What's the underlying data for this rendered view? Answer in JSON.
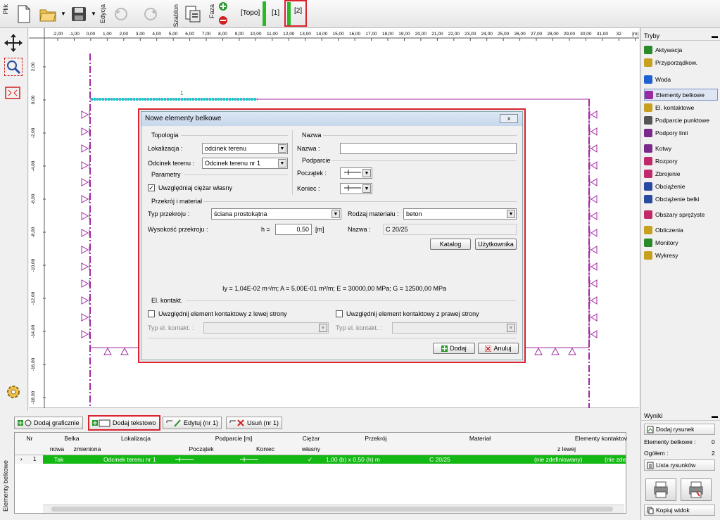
{
  "toolbar": {
    "file_label": "Plik",
    "edit_label": "Edycja",
    "template_label": "Szablon",
    "phase_label": "Faza",
    "phases": [
      "[Topo]",
      "[1]",
      "[2]"
    ]
  },
  "ruler": {
    "x_ticks": [
      "-2,00",
      "-1,00",
      "0,00",
      "1,00",
      "2,00",
      "3,00",
      "4,00",
      "5,00",
      "6,00",
      "7,00",
      "8,00",
      "9,00",
      "10,00",
      "11,00",
      "12,00",
      "13,00",
      "14,00",
      "15,00",
      "16,00",
      "17,00",
      "18,00",
      "19,00",
      "20,00",
      "21,00",
      "22,00",
      "23,00",
      "24,00",
      "25,00",
      "26,00",
      "27,00",
      "28,00",
      "29,00",
      "30,00",
      "31,00",
      "32",
      "[m]"
    ],
    "y_ticks": [
      "2,00",
      "0,00",
      "-2,00",
      "-4,00",
      "-6,00",
      "-8,00",
      "-10,00",
      "-12,00",
      "-14,00",
      "-16,00",
      "-18,00"
    ],
    "beam_number": "1"
  },
  "dialog": {
    "title": "Nowe elementy belkowe",
    "topology_header": "Topologia",
    "location_label": "Lokalizacja :",
    "location_value": "odcinek terenu",
    "segment_label": "Odcinek terenu :",
    "segment_value": "Odcinek terenu nr 1",
    "params_header": "Parametry",
    "self_weight_label": "Uwzględniaj ciężar własny",
    "self_weight_checked": "✓",
    "name_header": "Nazwa",
    "name_label": "Nazwa :",
    "name_value": "",
    "support_header": "Podparcie",
    "start_label": "Początek :",
    "end_label": "Koniec :",
    "section_header": "Przekrój i materiał",
    "section_type_label": "Typ przekroju :",
    "section_type_value": "ściana prostokątna",
    "height_label": "Wysokość przekroju :",
    "height_symbol": "h =",
    "height_value": "0,50",
    "height_unit": "[m]",
    "material_type_label": "Rodzaj materiału :",
    "material_type_value": "beton",
    "material_name_label": "Nazwa :",
    "material_name_value": "C 20/25",
    "catalog_button": "Katalog",
    "user_button": "Użytkownika",
    "properties_line": "Iy = 1,04E-02 m⁴/m; A = 5,00E-01 m²/m; E = 30000,00 MPa; G = 12500,00 MPa",
    "contact_header": "El. kontakt.",
    "contact_left_label": "Uwzględnij element kontaktowy z lewej strony",
    "contact_right_label": "Uwzględnij element kontaktowy z prawej strony",
    "contact_type_left_label": "Typ el. kontakt. :",
    "contact_type_right_label": "Typ el. kontakt. :",
    "add_button": "Dodaj",
    "cancel_button": "Anuluj",
    "close_icon": "x"
  },
  "bottom": {
    "panel_label": "Elementy belkowe",
    "add_graphic": "Dodaj graficznie",
    "add_text": "Dodaj tekstowo",
    "edit": "Edytuj (nr 1)",
    "delete": "Usuń (nr 1)",
    "headers": {
      "nr": "Nr",
      "beam": "Belka",
      "beam_new": "nowa",
      "beam_modified": "zmieniona",
      "location": "Lokalizacja",
      "supports": "Podparcie [m]",
      "start": "Początek",
      "end": "Koniec",
      "weight": "Ciężar",
      "weight_own": "własny",
      "section": "Przekrój",
      "material": "Materiał",
      "contacts": "Elementy kontaktov",
      "contacts_left": "z lewej"
    },
    "row": {
      "nr": "1",
      "new": "Tak",
      "location": "Odcinek terenu nr 1",
      "weight": "✓",
      "section": "1,00 (b) x 0,50 (h) m",
      "material": "C 20/25",
      "contact_left": "(nie zdefiniowany)",
      "contact_right": "(nie zde"
    }
  },
  "right_panel": {
    "modes_title": "Tryby",
    "items": [
      {
        "label": "Aktywacja",
        "icon": "activation-icon",
        "color": "#2a8a2a"
      },
      {
        "label": "Przyporządkow.",
        "icon": "assign-icon",
        "color": "#c8a020"
      },
      {
        "label": "Woda",
        "icon": "water-icon",
        "color": "#2060d0"
      },
      {
        "label": "Elementy belkowe",
        "icon": "beam-icon",
        "color": "#9a2aa0"
      },
      {
        "label": "El. kontaktowe",
        "icon": "contact-icon",
        "color": "#c8a020"
      },
      {
        "label": "Podparcie punktowe",
        "icon": "point-support-icon",
        "color": "#555"
      },
      {
        "label": "Podpory linii",
        "icon": "line-support-icon",
        "color": "#7a2a8a"
      },
      {
        "label": "Kotwy",
        "icon": "anchor-icon",
        "color": "#7a2a8a"
      },
      {
        "label": "Rozpory",
        "icon": "strut-icon",
        "color": "#c02a6a"
      },
      {
        "label": "Zbrojenie",
        "icon": "reinforcement-icon",
        "color": "#c02a6a"
      },
      {
        "label": "Obciążenie",
        "icon": "load-icon",
        "color": "#2a4aa0"
      },
      {
        "label": "Obciążenie belki",
        "icon": "beam-load-icon",
        "color": "#2a4aa0"
      },
      {
        "label": "Obszary sprężyste",
        "icon": "elastic-icon",
        "color": "#c02a6a"
      },
      {
        "label": "Obliczenia",
        "icon": "calculation-icon",
        "color": "#c8a020"
      },
      {
        "label": "Monitory",
        "icon": "monitor-icon",
        "color": "#2a8a2a"
      },
      {
        "label": "Wykresy",
        "icon": "chart-icon",
        "color": "#c8a020"
      }
    ],
    "results_title": "Wyniki",
    "add_drawing": "Dodaj rysunek",
    "beam_elements_label": "Elementy belkowe :",
    "beam_elements_value": "0",
    "total_label": "Ogółem :",
    "total_value": "2",
    "drawing_list": "Lista rysunków",
    "copy_view": "Kopiuj widok"
  }
}
